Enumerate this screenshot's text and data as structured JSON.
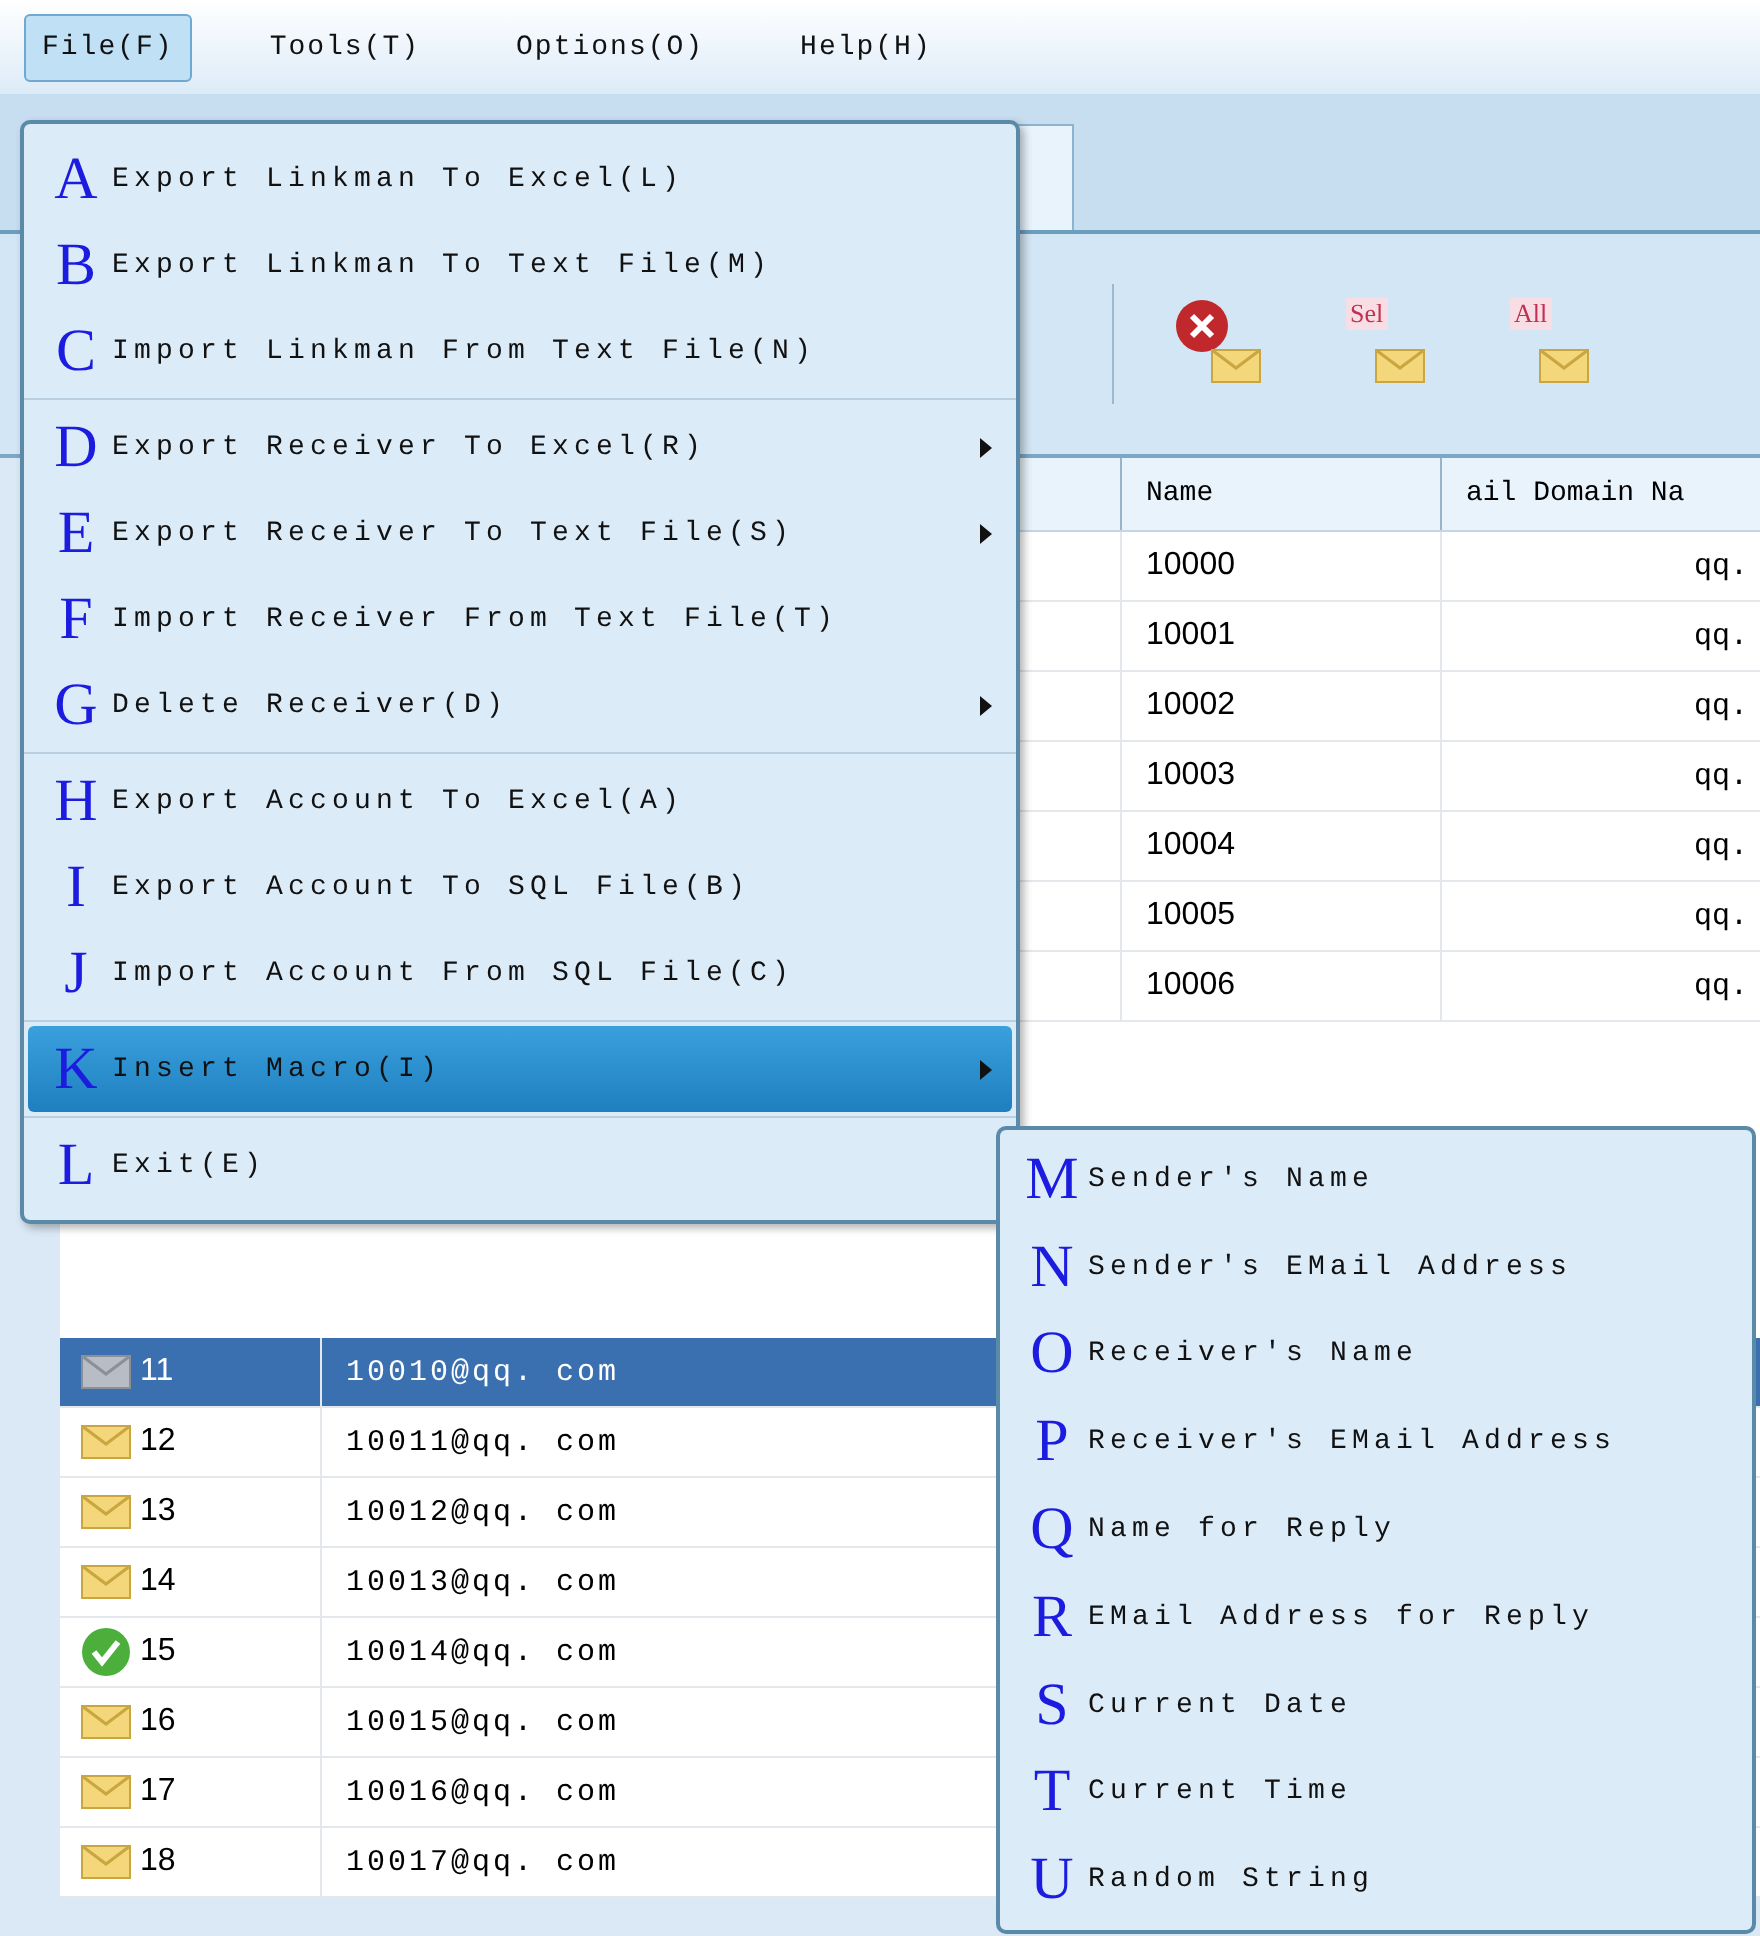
{
  "menubar": [
    {
      "label": "File(F)",
      "selected": true
    },
    {
      "label": "Tools(T)",
      "selected": false
    },
    {
      "label": "Options(O)",
      "selected": false
    },
    {
      "label": "Help(H)",
      "selected": false
    }
  ],
  "toolbar": [
    {
      "kind": "delete"
    },
    {
      "kind": "tag",
      "label": "Sel"
    },
    {
      "kind": "tag",
      "label": "All"
    }
  ],
  "table": {
    "columns": [
      "Name",
      "ail Domain Na"
    ],
    "upper_rows": [
      {
        "name": "10000",
        "domain": "qq."
      },
      {
        "name": "10001",
        "domain": "qq."
      },
      {
        "name": "10002",
        "domain": "qq."
      },
      {
        "name": "10003",
        "domain": "qq."
      },
      {
        "name": "10004",
        "domain": "qq."
      },
      {
        "name": "10005",
        "domain": "qq."
      },
      {
        "name": "10006",
        "domain": "qq."
      }
    ],
    "lower_rows": [
      {
        "number": "11",
        "email": "10010@qq. com",
        "kind": "mail",
        "selected": true
      },
      {
        "number": "12",
        "email": "10011@qq. com",
        "kind": "mail",
        "selected": false
      },
      {
        "number": "13",
        "email": "10012@qq. com",
        "kind": "mail",
        "selected": false
      },
      {
        "number": "14",
        "email": "10013@qq. com",
        "kind": "mail",
        "selected": false
      },
      {
        "number": "15",
        "email": "10014@qq. com",
        "kind": "sent",
        "selected": false
      },
      {
        "number": "16",
        "email": "10015@qq. com",
        "kind": "mail",
        "selected": false
      },
      {
        "number": "17",
        "email": "10016@qq. com",
        "kind": "mail",
        "selected": false
      },
      {
        "number": "18",
        "email": "10017@qq. com",
        "kind": "mail",
        "selected": false
      }
    ]
  },
  "file_menu": {
    "groups": [
      [
        {
          "letter": "A",
          "label": "Export Linkman To Excel(L)",
          "submenu": false,
          "selected": false
        },
        {
          "letter": "B",
          "label": "Export Linkman To Text File(M)",
          "submenu": false,
          "selected": false
        },
        {
          "letter": "C",
          "label": "Import Linkman From Text File(N)",
          "submenu": false,
          "selected": false
        }
      ],
      [
        {
          "letter": "D",
          "label": "Export Receiver To Excel(R)",
          "submenu": true,
          "selected": false
        },
        {
          "letter": "E",
          "label": "Export Receiver To Text File(S)",
          "submenu": true,
          "selected": false
        },
        {
          "letter": "F",
          "label": "Import Receiver From Text File(T)",
          "submenu": false,
          "selected": false
        },
        {
          "letter": "G",
          "label": "Delete Receiver(D)",
          "submenu": true,
          "selected": false
        }
      ],
      [
        {
          "letter": "H",
          "label": "Export Account To Excel(A)",
          "submenu": false,
          "selected": false
        },
        {
          "letter": "I",
          "label": "Export Account To SQL File(B)",
          "submenu": false,
          "selected": false
        },
        {
          "letter": "J",
          "label": "Import Account From SQL File(C)",
          "submenu": false,
          "selected": false
        }
      ],
      [
        {
          "letter": "K",
          "label": "Insert Macro(I)",
          "submenu": true,
          "selected": true
        }
      ],
      [
        {
          "letter": "L",
          "label": "Exit(E)",
          "submenu": false,
          "selected": false
        }
      ]
    ]
  },
  "macro_submenu": [
    {
      "letter": "M",
      "label": "Sender's Name"
    },
    {
      "letter": "N",
      "label": "Sender's EMail Address"
    },
    {
      "letter": "O",
      "label": "Receiver's Name"
    },
    {
      "letter": "P",
      "label": "Receiver's EMail Address"
    },
    {
      "letter": "Q",
      "label": "Name for Reply"
    },
    {
      "letter": "R",
      "label": "EMail Address for Reply"
    },
    {
      "letter": "S",
      "label": "Current Date"
    },
    {
      "letter": "T",
      "label": "Current Time"
    },
    {
      "letter": "U",
      "label": "Random String"
    }
  ]
}
